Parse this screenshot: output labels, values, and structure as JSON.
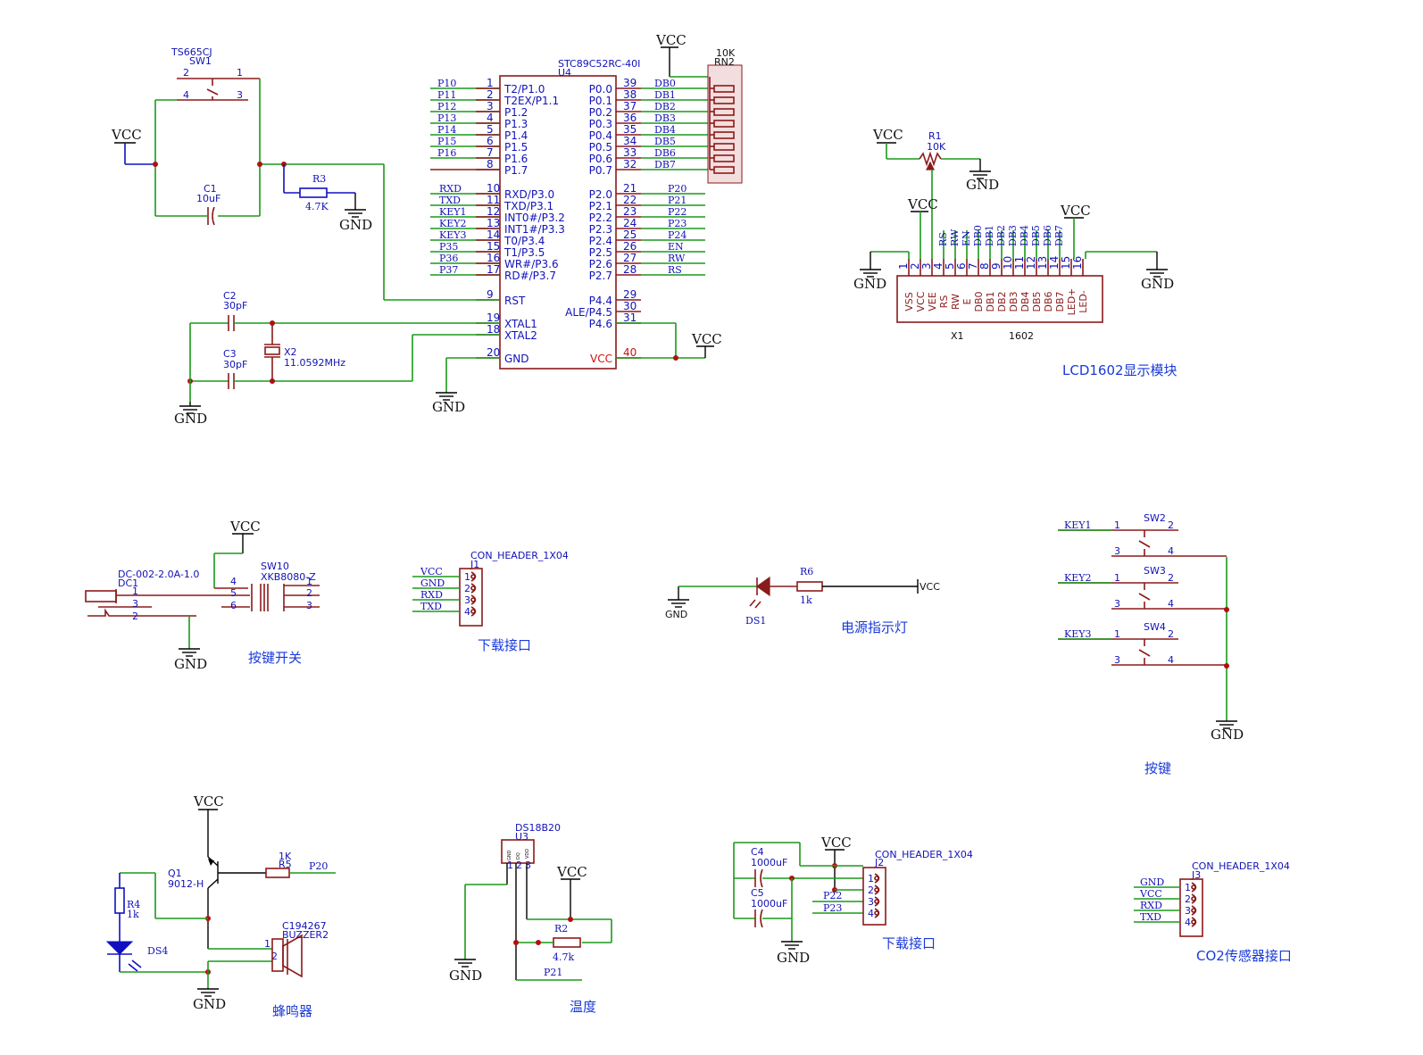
{
  "power": {
    "vcc": "VCC",
    "gnd": "GND"
  },
  "mcu": {
    "designator": "U4",
    "part": "STC89C52RC-40I",
    "left_pins": [
      {
        "num": "1",
        "name": "T2/P1.0",
        "net": "P10"
      },
      {
        "num": "2",
        "name": "T2EX/P1.1",
        "net": "P11"
      },
      {
        "num": "3",
        "name": "P1.2",
        "net": "P12"
      },
      {
        "num": "4",
        "name": "P1.3",
        "net": "P13"
      },
      {
        "num": "5",
        "name": "P1.4",
        "net": "P14"
      },
      {
        "num": "6",
        "name": "P1.5",
        "net": "P15"
      },
      {
        "num": "7",
        "name": "P1.6",
        "net": "P16"
      },
      {
        "num": "8",
        "name": "P1.7",
        "net": ""
      },
      {
        "num": "10",
        "name": "RXD/P3.0",
        "net": "RXD"
      },
      {
        "num": "11",
        "name": "TXD/P3.1",
        "net": "TXD"
      },
      {
        "num": "12",
        "name": "INT0#/P3.2",
        "net": "KEY1"
      },
      {
        "num": "13",
        "name": "INT1#/P3.3",
        "net": "KEY2"
      },
      {
        "num": "14",
        "name": "T0/P3.4",
        "net": "KEY3"
      },
      {
        "num": "15",
        "name": "T1/P3.5",
        "net": "P35"
      },
      {
        "num": "16",
        "name": "WR#/P3.6",
        "net": "P36"
      },
      {
        "num": "17",
        "name": "RD#/P3.7",
        "net": "P37"
      },
      {
        "num": "9",
        "name": "RST",
        "net": ""
      },
      {
        "num": "19",
        "name": "XTAL1",
        "net": ""
      },
      {
        "num": "18",
        "name": "XTAL2",
        "net": ""
      },
      {
        "num": "20",
        "name": "GND",
        "net": ""
      }
    ],
    "right_pins": [
      {
        "num": "39",
        "name": "P0.0",
        "net": "DB0"
      },
      {
        "num": "38",
        "name": "P0.1",
        "net": "DB1"
      },
      {
        "num": "37",
        "name": "P0.2",
        "net": "DB2"
      },
      {
        "num": "36",
        "name": "P0.3",
        "net": "DB3"
      },
      {
        "num": "35",
        "name": "P0.4",
        "net": "DB4"
      },
      {
        "num": "34",
        "name": "P0.5",
        "net": "DB5"
      },
      {
        "num": "33",
        "name": "P0.6",
        "net": "DB6"
      },
      {
        "num": "32",
        "name": "P0.7",
        "net": "DB7"
      },
      {
        "num": "21",
        "name": "P2.0",
        "net": "P20"
      },
      {
        "num": "22",
        "name": "P2.1",
        "net": "P21"
      },
      {
        "num": "23",
        "name": "P2.2",
        "net": "P22"
      },
      {
        "num": "24",
        "name": "P2.3",
        "net": "P23"
      },
      {
        "num": "25",
        "name": "P2.4",
        "net": "P24"
      },
      {
        "num": "26",
        "name": "P2.5",
        "net": "EN"
      },
      {
        "num": "27",
        "name": "P2.6",
        "net": "RW"
      },
      {
        "num": "28",
        "name": "P2.7",
        "net": "RS"
      },
      {
        "num": "29",
        "name": "P4.4",
        "net": ""
      },
      {
        "num": "30",
        "name": "ALE/P4.5",
        "net": ""
      },
      {
        "num": "31",
        "name": "P4.6",
        "net": ""
      },
      {
        "num": "40",
        "name": "VCC",
        "net": ""
      }
    ]
  },
  "rn2": {
    "designator": "RN2",
    "value": "10K"
  },
  "sw1": {
    "designator": "SW1",
    "part": "TS665CJ",
    "pins": [
      "2",
      "1",
      "4",
      "3"
    ]
  },
  "c1": {
    "designator": "C1",
    "value": "10uF"
  },
  "r3": {
    "designator": "R3",
    "value": "4.7K"
  },
  "c2": {
    "designator": "C2",
    "value": "30pF"
  },
  "c3": {
    "designator": "C3",
    "value": "30pF"
  },
  "x2": {
    "designator": "X2",
    "value": "11.0592MHz"
  },
  "r1": {
    "designator": "R1",
    "value": "10K"
  },
  "lcd": {
    "designator": "X1",
    "part": "1602",
    "title": "LCD1602显示模块",
    "pins": [
      {
        "num": "1",
        "name": "VSS",
        "net": ""
      },
      {
        "num": "2",
        "name": "VCC",
        "net": ""
      },
      {
        "num": "3",
        "name": "VEE",
        "net": ""
      },
      {
        "num": "4",
        "name": "RS",
        "net": "RS"
      },
      {
        "num": "5",
        "name": "RW",
        "net": "RW"
      },
      {
        "num": "6",
        "name": "E",
        "net": "EN"
      },
      {
        "num": "7",
        "name": "DB0",
        "net": "DB0"
      },
      {
        "num": "8",
        "name": "DB1",
        "net": "DB1"
      },
      {
        "num": "9",
        "name": "DB2",
        "net": "DB2"
      },
      {
        "num": "10",
        "name": "DB3",
        "net": "DB3"
      },
      {
        "num": "11",
        "name": "DB4",
        "net": "DB4"
      },
      {
        "num": "12",
        "name": "DB5",
        "net": "DB5"
      },
      {
        "num": "13",
        "name": "DB6",
        "net": "DB6"
      },
      {
        "num": "14",
        "name": "DB7",
        "net": "DB7"
      },
      {
        "num": "15",
        "name": "LED+",
        "net": ""
      },
      {
        "num": "16",
        "name": "LED-",
        "net": ""
      }
    ]
  },
  "dc1": {
    "designator": "DC1",
    "part": "DC-002-2.0A-1.0",
    "pins": [
      "1",
      "3",
      "2"
    ]
  },
  "sw10": {
    "designator": "SW10",
    "part": "XKB8080-Z",
    "left_pins": [
      "4",
      "5",
      "6"
    ],
    "right_pins": [
      "1",
      "2",
      "3"
    ],
    "title": "按键开关"
  },
  "j1": {
    "designator": "J1",
    "part": "CON_HEADER_1X04",
    "nets": [
      "VCC",
      "GND",
      "RXD",
      "TXD"
    ],
    "pins": [
      "1",
      "2",
      "3",
      "4"
    ],
    "title": "下载接口"
  },
  "ds1": {
    "designator": "DS1"
  },
  "r6": {
    "designator": "R6",
    "value": "1k",
    "title": "电源指示灯"
  },
  "keys": {
    "title": "按键",
    "items": [
      {
        "designator": "SW2",
        "net": "KEY1",
        "pins": [
          "1",
          "2",
          "3",
          "4"
        ]
      },
      {
        "designator": "SW3",
        "net": "KEY2",
        "pins": [
          "1",
          "2",
          "3",
          "4"
        ]
      },
      {
        "designator": "SW4",
        "net": "KEY3",
        "pins": [
          "1",
          "2",
          "3",
          "4"
        ]
      }
    ]
  },
  "buzzer": {
    "title": "蜂鸣器",
    "q1": {
      "designator": "Q1",
      "part": "9012-H"
    },
    "r5": {
      "designator": "R5",
      "value": "1K"
    },
    "r4": {
      "designator": "R4",
      "value": "1k"
    },
    "ds4": {
      "designator": "DS4"
    },
    "bz": {
      "designator": "BUZZER2",
      "part": "C194267",
      "pins": [
        "1",
        "2"
      ]
    },
    "net": "P20"
  },
  "temp": {
    "title": "温度",
    "u3": {
      "designator": "U3",
      "part": "DS18B20",
      "pins": [
        "GND",
        "DQ",
        "VDD"
      ],
      "pin_nums": [
        "1",
        "2",
        "3"
      ]
    },
    "r2": {
      "designator": "R2",
      "value": "4.7k"
    },
    "net": "P21"
  },
  "j2": {
    "designator": "J2",
    "part": "CON_HEADER_1X04",
    "title": "下载接口",
    "c4": {
      "designator": "C4",
      "value": "1000uF"
    },
    "c5": {
      "designator": "C5",
      "value": "1000uF"
    },
    "nets": [
      "P22",
      "P23"
    ],
    "pins": [
      "1",
      "2",
      "3",
      "4"
    ]
  },
  "j3": {
    "designator": "J3",
    "part": "CON_HEADER_1X04",
    "nets": [
      "GND",
      "VCC",
      "RXD",
      "TXD"
    ],
    "pins": [
      "1",
      "2",
      "3",
      "4"
    ],
    "title": "CO2传感器接口"
  }
}
